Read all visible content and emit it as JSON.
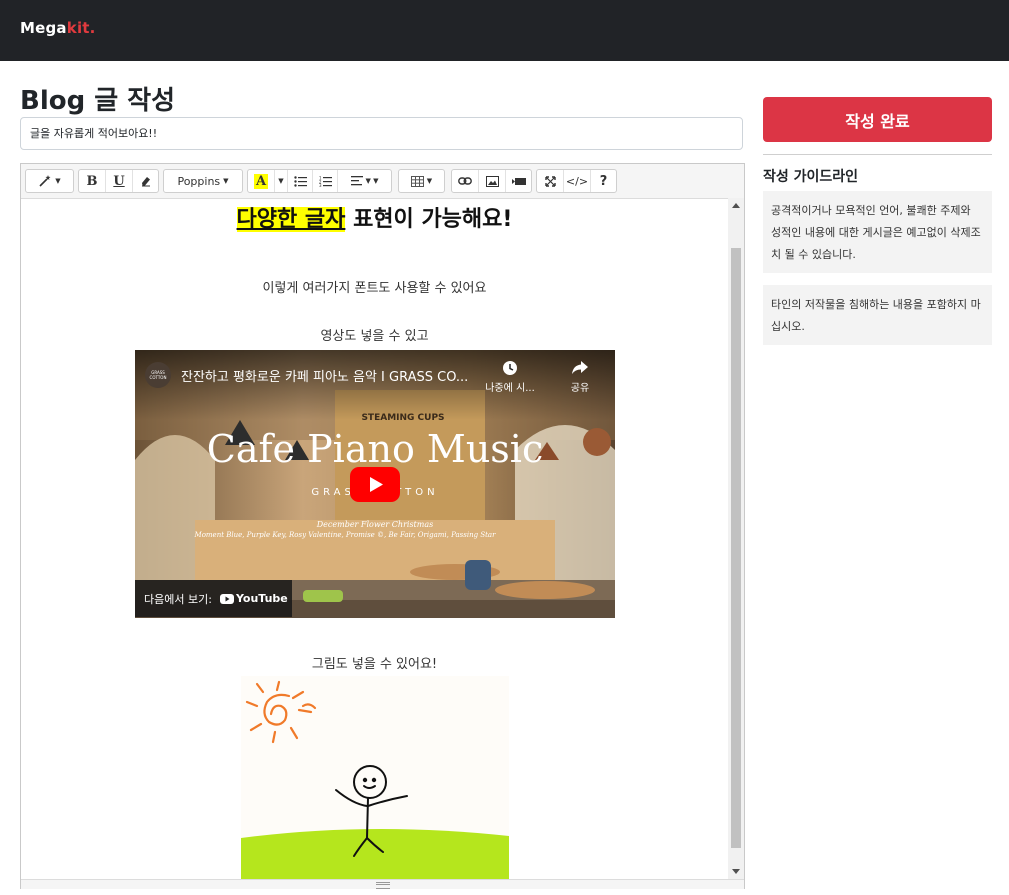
{
  "brand": {
    "name_main": "Mega",
    "name_accent": "kit."
  },
  "page": {
    "title": "Blog 글 작성"
  },
  "title_input": {
    "value": "글을 자유롭게 적어보아요!!"
  },
  "toolbar": {
    "font_name": "Poppins",
    "font_color_label": "A",
    "bold_label": "B",
    "underline_label": "U",
    "codeview_label": "</>",
    "help_label": "?"
  },
  "content": {
    "heading_highlight": "다양한 글자",
    "heading_rest": " 표현이 가능해요!",
    "para1": "이렇게 여러가지 폰트도 사용할 수 있어요",
    "para2": "영상도 넣을 수 있고",
    "para3": "그림도 넣을 수 있어요!",
    "video": {
      "channel_badge": "GRASS COTTON",
      "title": "잔잔하고 평화로운 카페 피아노 음악 I GRASS CO...",
      "watch_later": "나중에 시...",
      "share": "공유",
      "overlay_title": "Cafe Piano Music",
      "overlay_sub": "GRASS COTTON",
      "tracklist_1": "December Flower Christmas",
      "tracklist_2": "Moment Blue, Purple Key, Rosy Valentine, Promise ©, Be Fair, Origami, Passing Star",
      "shelf_sign": "STEAMING CUPS",
      "watch_on": "다음에서 보기:",
      "youtube": "YouTube"
    }
  },
  "sidebar": {
    "submit_label": "작성 완료",
    "guide_title": "작성 가이드라인",
    "guide_1": "공격적이거나 모욕적인 언어, 불쾌한 주제와 성적인 내용에 대한 게시글은 예고없이 삭제조치 될 수 있습니다.",
    "guide_2": "타인의 저작물을 침해하는 내용을 포함하지 마십시오."
  },
  "colors": {
    "navbar": "#212327",
    "accent": "#e03a3e",
    "submit": "#dc3545",
    "highlight": "#ffff00",
    "grass": "#b5e61d",
    "sun": "#f07a2a"
  },
  "icons": [
    "magic-icon",
    "bold-icon",
    "underline-icon",
    "eraser-icon",
    "font-color-icon",
    "unordered-list-icon",
    "ordered-list-icon",
    "align-icon",
    "table-icon",
    "link-icon",
    "picture-icon",
    "video-icon",
    "fullscreen-icon",
    "code-view-icon",
    "help-icon",
    "play-icon",
    "clock-icon",
    "share-icon"
  ]
}
